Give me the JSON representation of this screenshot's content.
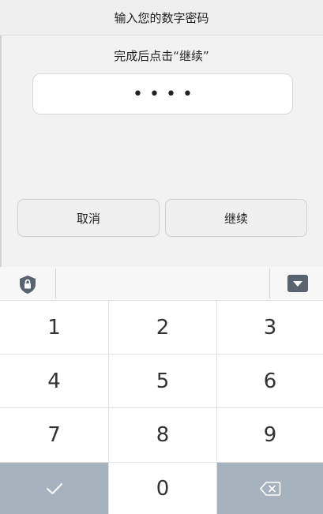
{
  "dialog": {
    "title": "输入您的数字密码",
    "instruction": "完成后点击“继续”",
    "pin_dots": "••••",
    "cancel_label": "取消",
    "continue_label": "继续"
  },
  "keyboard": {
    "toolbar_icons": [
      "shield-lock-icon",
      "collapse-keyboard-icon"
    ],
    "keys": [
      "1",
      "2",
      "3",
      "4",
      "5",
      "6",
      "7",
      "8",
      "9",
      "0"
    ],
    "special_keys": [
      "check-icon",
      "backspace-icon"
    ]
  },
  "colors": {
    "accent_dark_key": "#a7b2bf",
    "icon": "#5a6470"
  }
}
